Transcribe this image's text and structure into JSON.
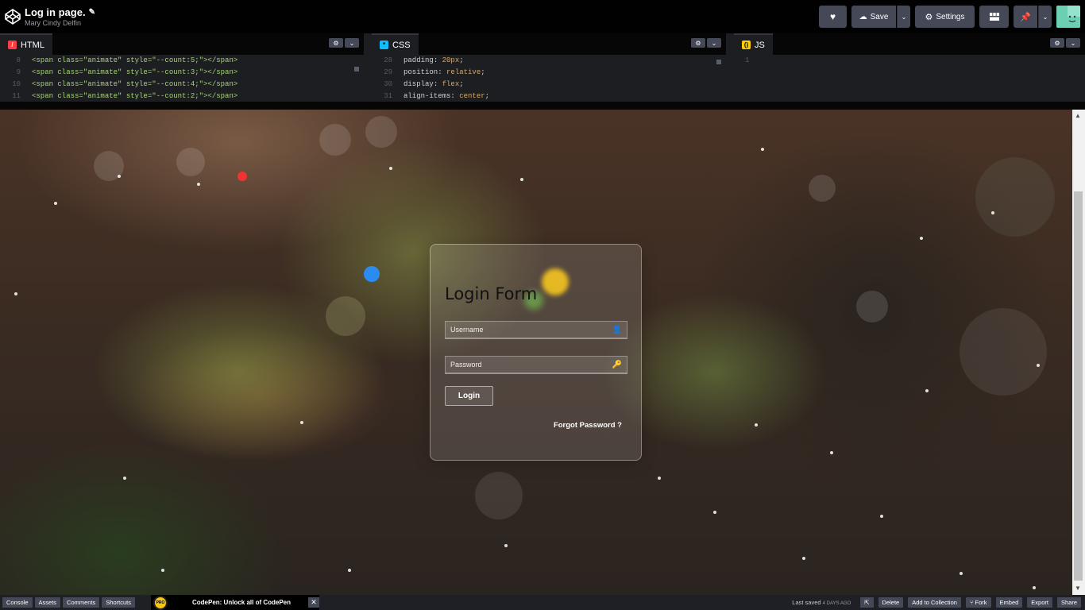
{
  "header": {
    "title": "Log in page.",
    "author": "Mary Cindy Delfin",
    "save_label": "Save",
    "settings_label": "Settings"
  },
  "editors": {
    "html": {
      "label": "HTML",
      "lines": [
        {
          "n": "8",
          "text": "<span class=\"animate\" style=\"--count:5;\"></span>"
        },
        {
          "n": "9",
          "text": "<span class=\"animate\" style=\"--count:3;\"></span>"
        },
        {
          "n": "10",
          "text": "<span class=\"animate\" style=\"--count:4;\"></span>"
        },
        {
          "n": "11",
          "text": "<span class=\"animate\" style=\"--count:2;\"></span>"
        }
      ]
    },
    "css": {
      "label": "CSS",
      "lines": [
        {
          "n": "28",
          "prop": "padding",
          "val": "20px"
        },
        {
          "n": "29",
          "prop": "position",
          "val": "relative"
        },
        {
          "n": "30",
          "prop": "display",
          "val": "flex"
        },
        {
          "n": "31",
          "prop": "align-items",
          "val": "center"
        }
      ]
    },
    "js": {
      "label": "JS",
      "lines": [
        {
          "n": "1",
          "text": ""
        }
      ]
    }
  },
  "login": {
    "title": "Login Form",
    "username_placeholder": "Username",
    "password_placeholder": "Password",
    "login_label": "Login",
    "forgot_label": "Forgot Password ?"
  },
  "footer": {
    "console": "Console",
    "assets": "Assets",
    "comments": "Comments",
    "shortcuts": "Shortcuts",
    "pro_badge": "PRO",
    "pro_text": "CodePen: Unlock all of CodePen",
    "last_saved": "Last saved",
    "last_saved_when": "4 DAYS AGO",
    "delete": "Delete",
    "add_to_collection": "Add to Collection",
    "fork": "Fork",
    "embed": "Embed",
    "export": "Export",
    "share": "Share"
  },
  "colors": {
    "accent_html": "#ff3c41",
    "accent_css": "#0ebeff",
    "accent_js": "#fcd000",
    "toolbar_button": "#444857"
  },
  "icons": [
    "codepen-logo-icon",
    "pencil-icon",
    "heart-icon",
    "cloud-icon",
    "gear-icon",
    "layout-icon",
    "pin-icon",
    "user-icon",
    "key-icon",
    "close-icon"
  ]
}
